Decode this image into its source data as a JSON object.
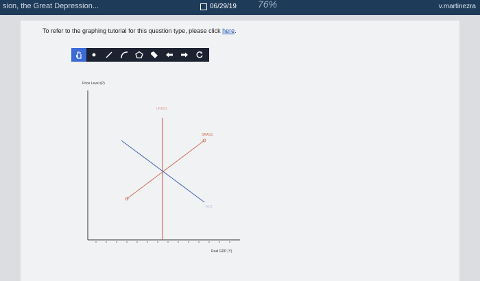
{
  "topbar": {
    "left_title": "sion, the Great Depression...",
    "date": "06/29/19",
    "battery": "76%",
    "user": "v.martinezra"
  },
  "instruction": {
    "text": "To refer to the graphing tutorial for this question type, please click ",
    "link": "here",
    "end": "."
  },
  "toolbar": {
    "icons": [
      "hand-icon",
      "point-icon",
      "line-icon",
      "curve-icon",
      "polygon-icon",
      "tag-icon",
      "undo-icon",
      "redo-icon",
      "reset-icon"
    ]
  },
  "graph": {
    "y_label": "Price Level (P)",
    "x_label": "Real GDP (Y)",
    "lras_label": "LRAS1",
    "sras_label": "SRAS1",
    "ad_label": "AD1",
    "colors": {
      "lras": "#c05050",
      "sras": "#c8705a",
      "ad": "#3a63b8",
      "axis": "#333333"
    }
  }
}
